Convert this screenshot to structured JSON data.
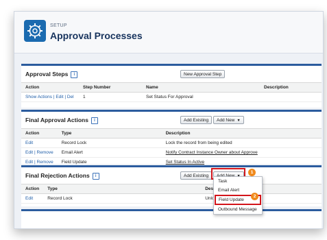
{
  "header": {
    "setup_label": "SETUP",
    "title": "Approval Processes"
  },
  "approval_steps": {
    "title": "Approval Steps",
    "help": "i",
    "new_button": "New Approval Step",
    "columns": [
      "Action",
      "Step Number",
      "Name",
      "Description"
    ],
    "row": {
      "show_actions": "Show Actions",
      "sep1": " | ",
      "edit": "Edit",
      "sep2": " | ",
      "del": "Del",
      "step": "1",
      "name": "Set Status For Approval",
      "description": ""
    }
  },
  "final_approval": {
    "title": "Final Approval Actions",
    "help": "i",
    "add_existing": "Add Existing",
    "add_new": "Add New",
    "caret": "▼",
    "columns": [
      "Action",
      "Type",
      "Description"
    ],
    "rows": [
      {
        "edit": "Edit",
        "sep": "",
        "remove": "",
        "type": "Record Lock",
        "description": "Lock the record from being edited"
      },
      {
        "edit": "Edit",
        "sep": " | ",
        "remove": "Remove",
        "type": "Email Alert",
        "description": "Notify Contract Instance Owner about Approve"
      },
      {
        "edit": "Edit",
        "sep": " | ",
        "remove": "Remove",
        "type": "Field Update",
        "description": "Set Status In Active"
      }
    ]
  },
  "final_rejection": {
    "title": "Final Rejection Actions",
    "help": "i",
    "add_existing": "Add Existing",
    "add_new": "Add New",
    "caret": "▼",
    "badge1": "1",
    "columns": [
      "Action",
      "Type",
      "Descr"
    ],
    "row": {
      "edit": "Edit",
      "type": "Record Lock",
      "description": "Unlo"
    }
  },
  "dropdown": {
    "items": [
      "Task",
      "Email Alert",
      "Field Update",
      "Outbound Message"
    ],
    "badge2": "2"
  },
  "colors": {
    "accent": "#2b5c9e",
    "highlight": "#d3141a",
    "badge": "#f08a1d",
    "link": "#1f5ea8"
  }
}
